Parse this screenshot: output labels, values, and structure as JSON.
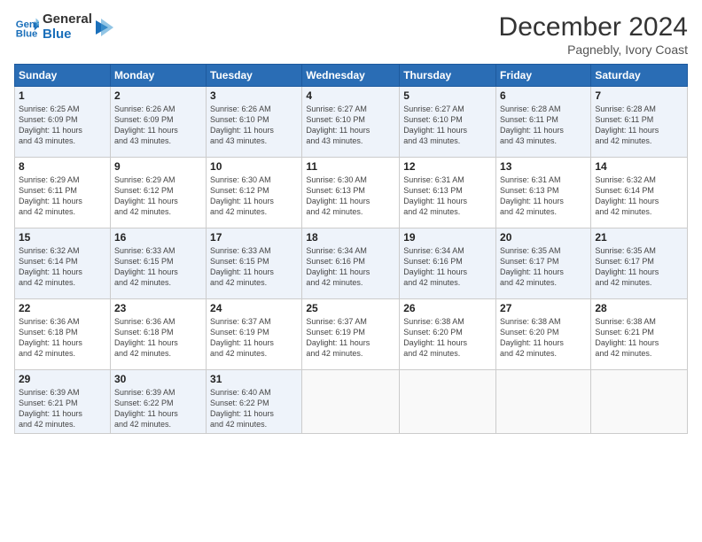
{
  "header": {
    "logo_line1": "General",
    "logo_line2": "Blue",
    "month": "December 2024",
    "location": "Pagnebly, Ivory Coast"
  },
  "days_of_week": [
    "Sunday",
    "Monday",
    "Tuesday",
    "Wednesday",
    "Thursday",
    "Friday",
    "Saturday"
  ],
  "weeks": [
    [
      {
        "day": "1",
        "info": "Sunrise: 6:25 AM\nSunset: 6:09 PM\nDaylight: 11 hours\nand 43 minutes."
      },
      {
        "day": "2",
        "info": "Sunrise: 6:26 AM\nSunset: 6:09 PM\nDaylight: 11 hours\nand 43 minutes."
      },
      {
        "day": "3",
        "info": "Sunrise: 6:26 AM\nSunset: 6:10 PM\nDaylight: 11 hours\nand 43 minutes."
      },
      {
        "day": "4",
        "info": "Sunrise: 6:27 AM\nSunset: 6:10 PM\nDaylight: 11 hours\nand 43 minutes."
      },
      {
        "day": "5",
        "info": "Sunrise: 6:27 AM\nSunset: 6:10 PM\nDaylight: 11 hours\nand 43 minutes."
      },
      {
        "day": "6",
        "info": "Sunrise: 6:28 AM\nSunset: 6:11 PM\nDaylight: 11 hours\nand 43 minutes."
      },
      {
        "day": "7",
        "info": "Sunrise: 6:28 AM\nSunset: 6:11 PM\nDaylight: 11 hours\nand 42 minutes."
      }
    ],
    [
      {
        "day": "8",
        "info": "Sunrise: 6:29 AM\nSunset: 6:11 PM\nDaylight: 11 hours\nand 42 minutes."
      },
      {
        "day": "9",
        "info": "Sunrise: 6:29 AM\nSunset: 6:12 PM\nDaylight: 11 hours\nand 42 minutes."
      },
      {
        "day": "10",
        "info": "Sunrise: 6:30 AM\nSunset: 6:12 PM\nDaylight: 11 hours\nand 42 minutes."
      },
      {
        "day": "11",
        "info": "Sunrise: 6:30 AM\nSunset: 6:13 PM\nDaylight: 11 hours\nand 42 minutes."
      },
      {
        "day": "12",
        "info": "Sunrise: 6:31 AM\nSunset: 6:13 PM\nDaylight: 11 hours\nand 42 minutes."
      },
      {
        "day": "13",
        "info": "Sunrise: 6:31 AM\nSunset: 6:13 PM\nDaylight: 11 hours\nand 42 minutes."
      },
      {
        "day": "14",
        "info": "Sunrise: 6:32 AM\nSunset: 6:14 PM\nDaylight: 11 hours\nand 42 minutes."
      }
    ],
    [
      {
        "day": "15",
        "info": "Sunrise: 6:32 AM\nSunset: 6:14 PM\nDaylight: 11 hours\nand 42 minutes."
      },
      {
        "day": "16",
        "info": "Sunrise: 6:33 AM\nSunset: 6:15 PM\nDaylight: 11 hours\nand 42 minutes."
      },
      {
        "day": "17",
        "info": "Sunrise: 6:33 AM\nSunset: 6:15 PM\nDaylight: 11 hours\nand 42 minutes."
      },
      {
        "day": "18",
        "info": "Sunrise: 6:34 AM\nSunset: 6:16 PM\nDaylight: 11 hours\nand 42 minutes."
      },
      {
        "day": "19",
        "info": "Sunrise: 6:34 AM\nSunset: 6:16 PM\nDaylight: 11 hours\nand 42 minutes."
      },
      {
        "day": "20",
        "info": "Sunrise: 6:35 AM\nSunset: 6:17 PM\nDaylight: 11 hours\nand 42 minutes."
      },
      {
        "day": "21",
        "info": "Sunrise: 6:35 AM\nSunset: 6:17 PM\nDaylight: 11 hours\nand 42 minutes."
      }
    ],
    [
      {
        "day": "22",
        "info": "Sunrise: 6:36 AM\nSunset: 6:18 PM\nDaylight: 11 hours\nand 42 minutes."
      },
      {
        "day": "23",
        "info": "Sunrise: 6:36 AM\nSunset: 6:18 PM\nDaylight: 11 hours\nand 42 minutes."
      },
      {
        "day": "24",
        "info": "Sunrise: 6:37 AM\nSunset: 6:19 PM\nDaylight: 11 hours\nand 42 minutes."
      },
      {
        "day": "25",
        "info": "Sunrise: 6:37 AM\nSunset: 6:19 PM\nDaylight: 11 hours\nand 42 minutes."
      },
      {
        "day": "26",
        "info": "Sunrise: 6:38 AM\nSunset: 6:20 PM\nDaylight: 11 hours\nand 42 minutes."
      },
      {
        "day": "27",
        "info": "Sunrise: 6:38 AM\nSunset: 6:20 PM\nDaylight: 11 hours\nand 42 minutes."
      },
      {
        "day": "28",
        "info": "Sunrise: 6:38 AM\nSunset: 6:21 PM\nDaylight: 11 hours\nand 42 minutes."
      }
    ],
    [
      {
        "day": "29",
        "info": "Sunrise: 6:39 AM\nSunset: 6:21 PM\nDaylight: 11 hours\nand 42 minutes."
      },
      {
        "day": "30",
        "info": "Sunrise: 6:39 AM\nSunset: 6:22 PM\nDaylight: 11 hours\nand 42 minutes."
      },
      {
        "day": "31",
        "info": "Sunrise: 6:40 AM\nSunset: 6:22 PM\nDaylight: 11 hours\nand 42 minutes."
      },
      {
        "day": "",
        "info": ""
      },
      {
        "day": "",
        "info": ""
      },
      {
        "day": "",
        "info": ""
      },
      {
        "day": "",
        "info": ""
      }
    ]
  ]
}
